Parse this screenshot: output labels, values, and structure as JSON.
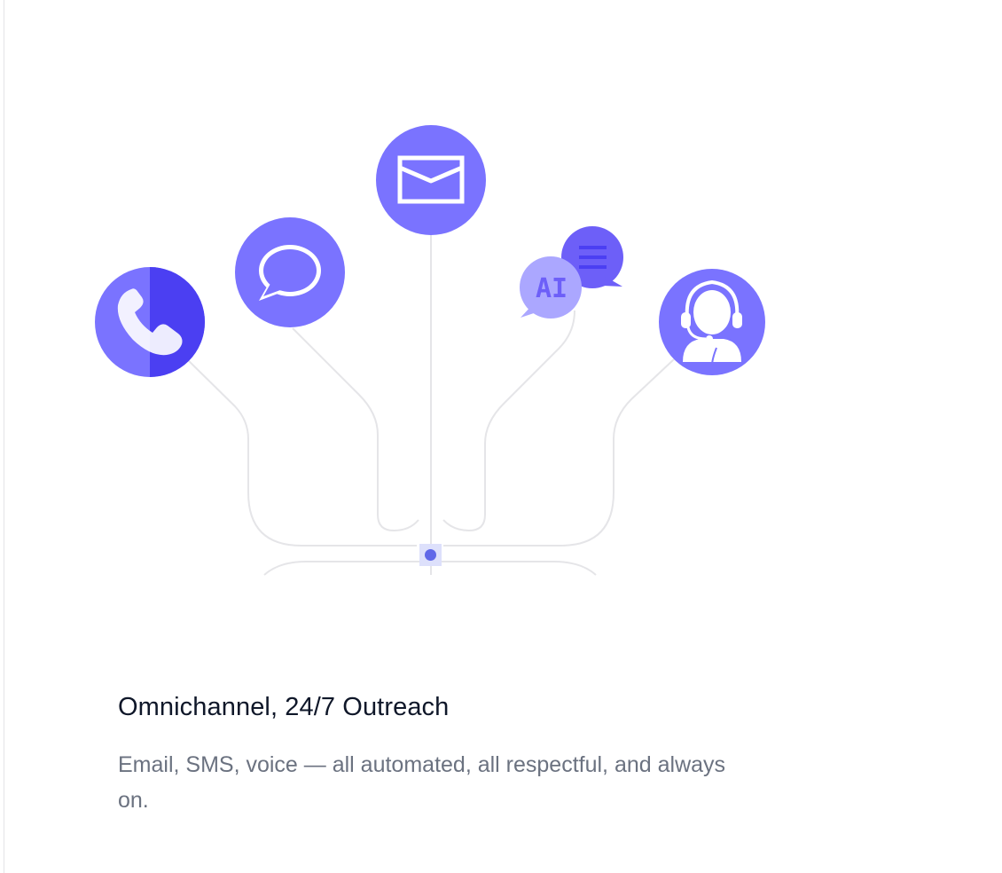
{
  "card": {
    "title": "Omnichannel, 24/7 Outreach",
    "description": "Email, SMS, voice — all automated, all respectful, and always on."
  },
  "channels": [
    {
      "name": "phone-icon"
    },
    {
      "name": "chat-bubble-icon"
    },
    {
      "name": "email-icon"
    },
    {
      "name": "ai-chat-icon",
      "label": "AI"
    },
    {
      "name": "support-agent-icon"
    }
  ],
  "colors": {
    "accent": "#7a73ff",
    "accent_dark": "#4b3ff2",
    "accent_light": "#aba7ff",
    "connector": "#e5e5e8",
    "hub": "#6068e8",
    "title": "#0f1729",
    "text": "#6b7280"
  }
}
